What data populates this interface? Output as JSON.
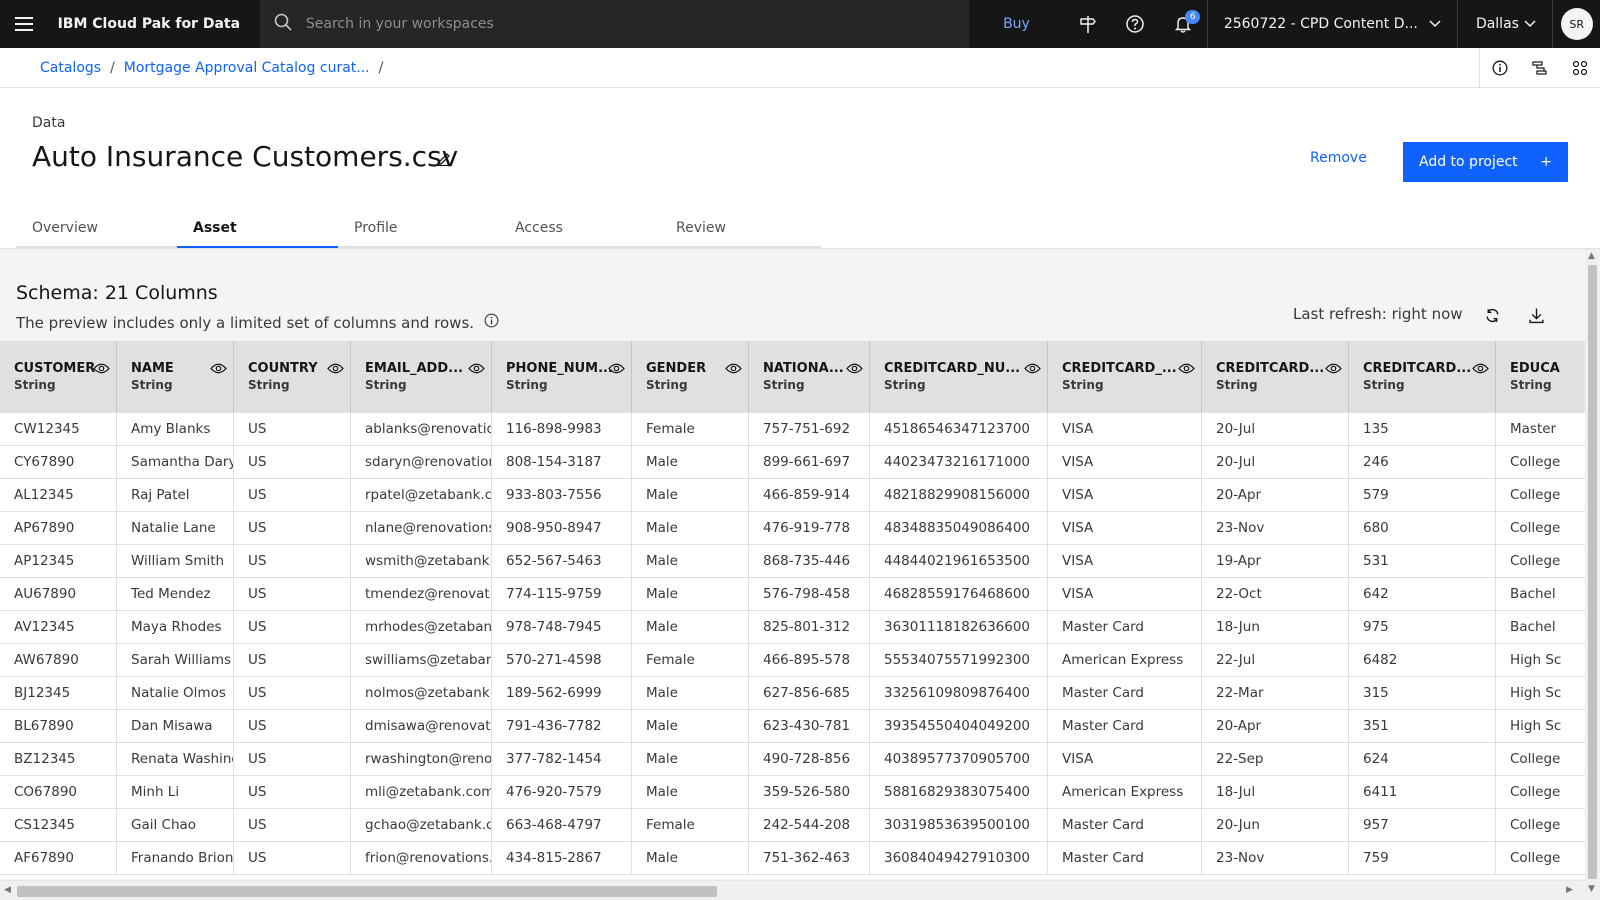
{
  "header": {
    "brand": "IBM Cloud Pak for Data",
    "search_placeholder": "Search in your workspaces",
    "buy_label": "Buy",
    "notification_count": "6",
    "account": "2560722 - CPD Content D...",
    "region": "Dallas",
    "avatar_initials": "SR"
  },
  "breadcrumb": {
    "items": [
      "Catalogs",
      "Mortgage Approval Catalog curat..."
    ],
    "separator": "/"
  },
  "asset": {
    "type_label": "Data",
    "title": "Auto Insurance Customers.csv",
    "remove_label": "Remove",
    "add_label": "Add to project",
    "add_icon": "+"
  },
  "tabs": [
    {
      "label": "Overview"
    },
    {
      "label": "Asset"
    },
    {
      "label": "Profile"
    },
    {
      "label": "Access"
    },
    {
      "label": "Review"
    }
  ],
  "active_tab": "Asset",
  "schema": {
    "title": "Schema:  21 Columns",
    "subtitle": "The preview includes only a limited set of columns and rows.",
    "last_refresh": "Last refresh: right now"
  },
  "table": {
    "columns": [
      {
        "name": "CUSTOMER",
        "type": "String"
      },
      {
        "name": "NAME",
        "type": "String"
      },
      {
        "name": "COUNTRY",
        "type": "String"
      },
      {
        "name": "EMAIL_ADD...",
        "type": "String"
      },
      {
        "name": "PHONE_NUM...",
        "type": "String"
      },
      {
        "name": "GENDER",
        "type": "String"
      },
      {
        "name": "NATIONA...",
        "type": "String"
      },
      {
        "name": "CREDITCARD_NU...",
        "type": "String"
      },
      {
        "name": "CREDITCARD_...",
        "type": "String"
      },
      {
        "name": "CREDITCARD...",
        "type": "String"
      },
      {
        "name": "CREDITCARD...",
        "type": "String"
      },
      {
        "name": "EDUCA",
        "type": "String"
      }
    ],
    "rows": [
      [
        "CW12345",
        "Amy Blanks",
        "US",
        "ablanks@renovations",
        "116-898-9983",
        "Female",
        "757-751-692",
        "45186546347123700",
        "VISA",
        "20-Jul",
        "135",
        "Master"
      ],
      [
        "CY67890",
        "Samantha Daryn",
        "US",
        "sdaryn@renovations",
        "808-154-3187",
        "Male",
        "899-661-697",
        "44023473216171000",
        "VISA",
        "20-Jul",
        "246",
        "College"
      ],
      [
        "AL12345",
        "Raj Patel",
        "US",
        "rpatel@zetabank.com",
        "933-803-7556",
        "Male",
        "466-859-914",
        "48218829908156000",
        "VISA",
        "20-Apr",
        "579",
        "College"
      ],
      [
        "AP67890",
        "Natalie Lane",
        "US",
        "nlane@renovations.c",
        "908-950-8947",
        "Male",
        "476-919-778",
        "48348835049086400",
        "VISA",
        "23-Nov",
        "680",
        "College"
      ],
      [
        "AP12345",
        "William Smith",
        "US",
        "wsmith@zetabank.co",
        "652-567-5463",
        "Male",
        "868-735-446",
        "44844021961653500",
        "VISA",
        "19-Apr",
        "531",
        "College"
      ],
      [
        "AU67890",
        "Ted Mendez",
        "US",
        "tmendez@renovation",
        "774-115-9759",
        "Male",
        "576-798-458",
        "46828559176468600",
        "VISA",
        "22-Oct",
        "642",
        "Bachel"
      ],
      [
        "AV12345",
        "Maya Rhodes",
        "US",
        "mrhodes@zetabank.",
        "978-748-7945",
        "Male",
        "825-801-312",
        "36301118182636600",
        "Master Card",
        "18-Jun",
        "975",
        "Bachel"
      ],
      [
        "AW67890",
        "Sarah Williams",
        "US",
        "swilliams@zetabank.",
        "570-271-4598",
        "Female",
        "466-895-578",
        "55534075571992300",
        "American Express",
        "22-Jul",
        "6482",
        "High Sc"
      ],
      [
        "BJ12345",
        "Natalie Olmos",
        "US",
        "nolmos@zetabank.co",
        "189-562-6999",
        "Male",
        "627-856-685",
        "33256109809876400",
        "Master Card",
        "22-Mar",
        "315",
        "High Sc"
      ],
      [
        "BL67890",
        "Dan Misawa",
        "US",
        "dmisawa@renovation",
        "791-436-7782",
        "Male",
        "623-430-781",
        "39354550404049200",
        "Master Card",
        "20-Apr",
        "351",
        "High Sc"
      ],
      [
        "BZ12345",
        "Renata Washingt",
        "US",
        "rwashington@renova",
        "377-782-1454",
        "Male",
        "490-728-856",
        "40389577370905700",
        "VISA",
        "22-Sep",
        "624",
        "College"
      ],
      [
        "CO67890",
        "Minh Li",
        "US",
        "mli@zetabank.com",
        "476-920-7579",
        "Male",
        "359-526-580",
        "58816829383075400",
        "American Express",
        "18-Jul",
        "6411",
        "College"
      ],
      [
        "CS12345",
        "Gail Chao",
        "US",
        "gchao@zetabank.com",
        "663-468-4797",
        "Female",
        "242-544-208",
        "30319853639500100",
        "Master Card",
        "20-Jun",
        "957",
        "College"
      ],
      [
        "AF67890",
        "Franando Brion",
        "US",
        "frion@renovations.c",
        "434-815-2867",
        "Male",
        "751-362-463",
        "36084049427910300",
        "Master Card",
        "23-Nov",
        "759",
        "College"
      ]
    ]
  },
  "icons": {
    "menu": "hamburger-icon",
    "search": "search-icon",
    "launch": "signpost-icon",
    "help": "help-icon",
    "notifications": "bell-icon",
    "edit": "pencil-icon",
    "refresh": "refresh-icon",
    "download": "download-icon",
    "column_visibility": "eye-icon"
  },
  "colors": {
    "accent": "#0f62fe",
    "header_bg": "#161616",
    "table_header_bg": "#e0e0e0"
  }
}
